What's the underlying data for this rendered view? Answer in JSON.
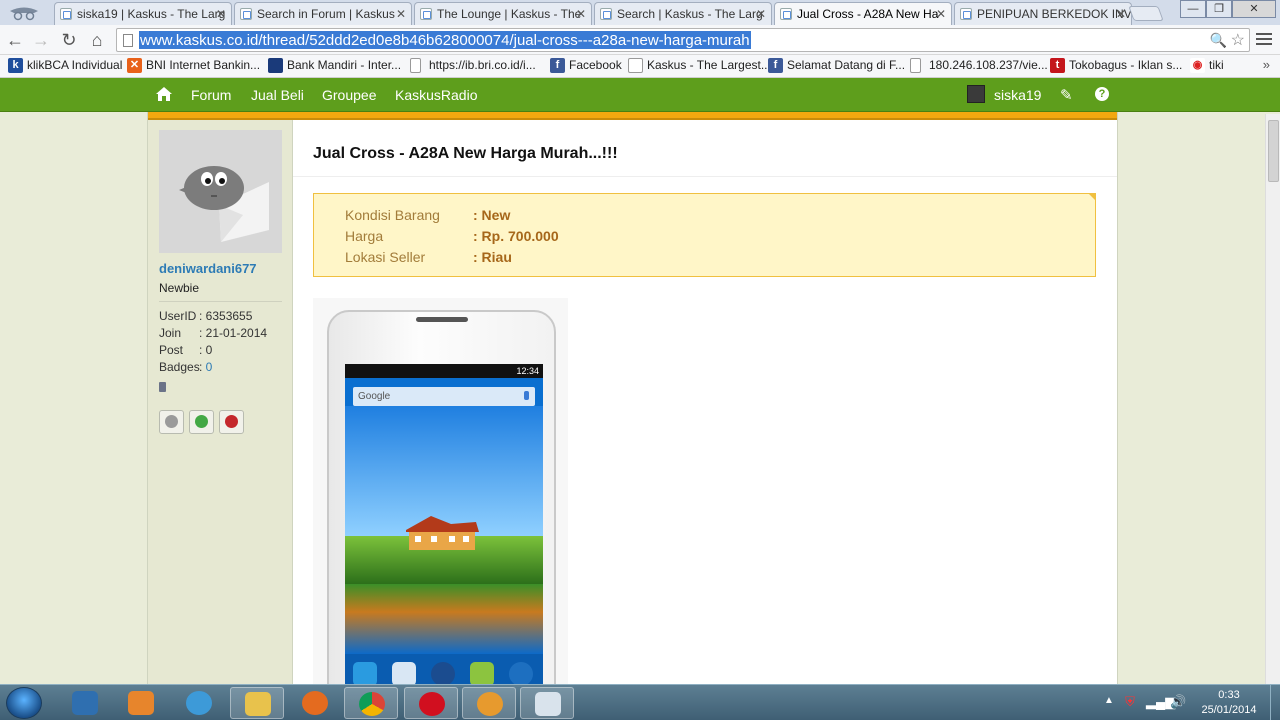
{
  "browser": {
    "tabs": [
      {
        "label": "siska19 | Kaskus - The Larg"
      },
      {
        "label": "Search in Forum | Kaskus"
      },
      {
        "label": "The Lounge | Kaskus - The"
      },
      {
        "label": "Search | Kaskus - The Larg"
      },
      {
        "label": "Jual Cross - A28A New Ha"
      },
      {
        "label": "PENIPUAN BERKEDOK INV"
      }
    ],
    "url": "www.kaskus.co.id/thread/52ddd2ed0e8b46b628000074/jual-cross---a28a-new-harga-murah",
    "bookmarks": [
      {
        "label": "klikBCA Individual",
        "icon": "klikbca-icon",
        "color": "#1f4e9c"
      },
      {
        "label": "BNI Internet Bankin...",
        "icon": "bni-icon",
        "color": "#e8611a"
      },
      {
        "label": "Bank Mandiri - Inter...",
        "icon": "mandiri-icon",
        "color": "#1a3a7a"
      },
      {
        "label": "https://ib.bri.co.id/i...",
        "icon": "page-icon",
        "color": "#ffffff"
      },
      {
        "label": "Facebook",
        "icon": "facebook-icon",
        "color": "#3b5998"
      },
      {
        "label": "Kaskus - The Largest...",
        "icon": "kaskus-icon",
        "color": "#ffffff"
      },
      {
        "label": "Selamat Datang di F...",
        "icon": "facebook-icon",
        "color": "#3b5998"
      },
      {
        "label": "180.246.108.237/vie...",
        "icon": "page-icon",
        "color": "#ffffff"
      },
      {
        "label": "Tokobagus - Iklan s...",
        "icon": "tokobagus-icon",
        "color": "#c4161c"
      },
      {
        "label": "tiki",
        "icon": "tiki-icon",
        "color": "#ffffff"
      }
    ],
    "more": "»"
  },
  "kaskus_nav": {
    "items": [
      "Forum",
      "Jual Beli",
      "Groupee",
      "KaskusRadio"
    ],
    "username": "siska19",
    "help": "?"
  },
  "poster": {
    "username": "deniwardani677",
    "rank": "Newbie",
    "stats": [
      {
        "key": "UserID",
        "value": ": 6353655"
      },
      {
        "key": "Join",
        "value": ": 21-01-2014"
      },
      {
        "key": "Post",
        "value": ": 0"
      },
      {
        "key": "Badges",
        "value": ": ",
        "link": "0"
      }
    ]
  },
  "thread": {
    "title": "Jual Cross - A28A New Harga Murah...!!!",
    "info": [
      {
        "label": "Kondisi Barang",
        "value": ": New"
      },
      {
        "label": "Harga",
        "value": ": Rp. 700.000"
      },
      {
        "label": "Lokasi Seller",
        "value": ": Riau"
      }
    ],
    "phone_screen": {
      "status_time": "12:34",
      "search_label": "Google"
    }
  },
  "taskbar": {
    "clock_time": "0:33",
    "clock_date": "25/01/2014",
    "apps": [
      "app-store-icon",
      "media-player-icon",
      "internet-explorer-icon",
      "file-explorer-icon",
      "firefox-icon",
      "chrome-icon",
      "opera-icon",
      "app-icon",
      "paint-icon"
    ]
  },
  "colors": {
    "kaskus_green": "#5e9e1c",
    "kaskus_orange": "#f3a80f",
    "info_bg": "#fff6c8",
    "username_blue": "#2d7bb5"
  }
}
